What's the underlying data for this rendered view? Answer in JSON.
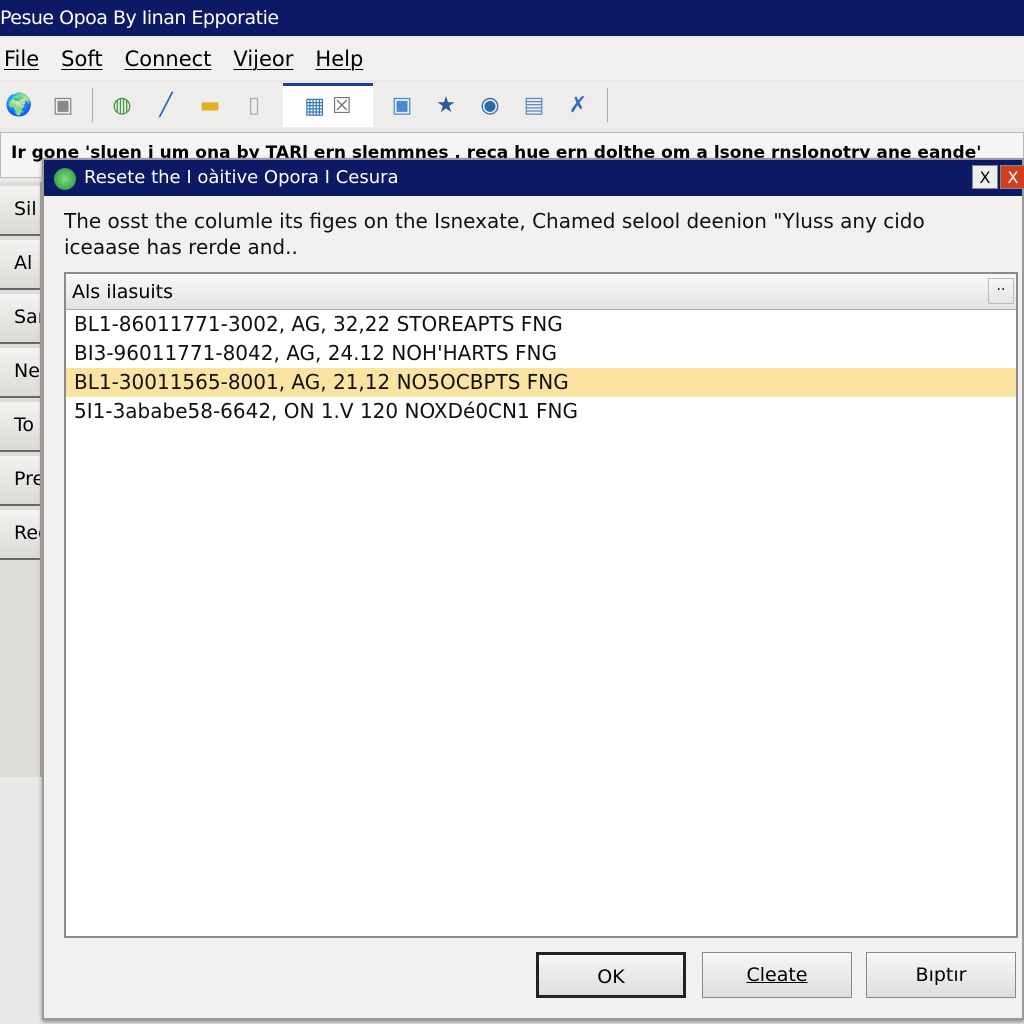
{
  "window": {
    "title": "Pesue Opoa By Iinan Epporatie"
  },
  "menu": [
    "File",
    "Soft",
    "Connect",
    "Vijeor",
    "Help"
  ],
  "toolbar": {
    "icons": [
      "globe-folder-icon",
      "document-icon",
      "globe-icon",
      "pen-icon",
      "panel-icon",
      "blank-page-icon",
      "image-icon",
      "envelope-icon",
      "window-icon",
      "star-folder-icon",
      "refresh-globe-icon",
      "document-gear-icon",
      "tools-icon"
    ]
  },
  "status_text": "Ir gone 'sluen i um ona by TARl ern slemmnes , reca hue ern dolthe om a lsone rnslonotry ane eande'",
  "sidebar": [
    "Sil",
    "Al R",
    "Sar",
    "Nev",
    "To",
    "Pre",
    "Rec"
  ],
  "dialog": {
    "title": "Resete the I oàitive Opora I Cesura",
    "message_line1": "The osst the columle its figes on the Isnexate, Chamed selool deenion \"Yluss any cido",
    "message_line2": "iceaase has rerde  and..",
    "list_header": "Als ilasuits",
    "list_header_button": "··",
    "rows": [
      "BL1-86011771-3002, AG, 32,22 STOREAPTS FNG",
      "BI3-96011771-8042, AG, 24.12 NOH'HARTS FNG",
      "BL1-30011565-8001, AG, 21,12 NO5OCBPTS FNG",
      "5I1-3ababe58-6642, ON 1.V 120 NOXDé0CN1 FNG"
    ],
    "selected_row": 2,
    "buttons": {
      "ok": "OK",
      "create": "Cleate",
      "other": "Bıptır"
    },
    "close_label": "X"
  }
}
